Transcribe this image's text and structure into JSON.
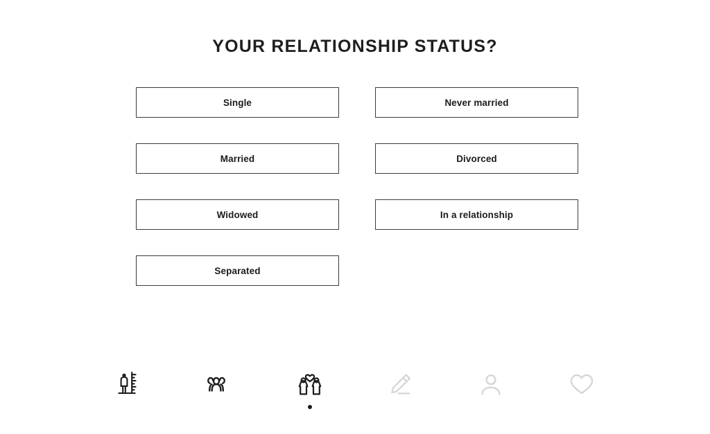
{
  "page": {
    "title": "YOUR RELATIONSHIP STATUS?",
    "background_color": "#ffffff",
    "text_color": "#1b1b1b",
    "border_color": "#3b3b3b",
    "inactive_icon_color": "#d6d6d6"
  },
  "options": [
    {
      "label": "Single",
      "column": "left"
    },
    {
      "label": "Never married",
      "column": "right"
    },
    {
      "label": "Married",
      "column": "left"
    },
    {
      "label": "Divorced",
      "column": "right"
    },
    {
      "label": "Widowed",
      "column": "left"
    },
    {
      "label": "In a relationship",
      "column": "right"
    },
    {
      "label": "Separated",
      "column": "left"
    }
  ],
  "bottom_nav": {
    "items": [
      {
        "icon": "body-measurement-icon",
        "name": "nav-body-measurement",
        "active": false,
        "color": "#1b1b1b"
      },
      {
        "icon": "people-group-icon",
        "name": "nav-people-group",
        "active": false,
        "color": "#1b1b1b"
      },
      {
        "icon": "couple-heart-icon",
        "name": "nav-relationship",
        "active": true,
        "color": "#1b1b1b"
      },
      {
        "icon": "pencil-icon",
        "name": "nav-edit",
        "active": false,
        "color": "#d6d6d6"
      },
      {
        "icon": "person-icon",
        "name": "nav-profile",
        "active": false,
        "color": "#d6d6d6"
      },
      {
        "icon": "heart-icon",
        "name": "nav-favorites",
        "active": false,
        "color": "#d6d6d6"
      }
    ]
  }
}
